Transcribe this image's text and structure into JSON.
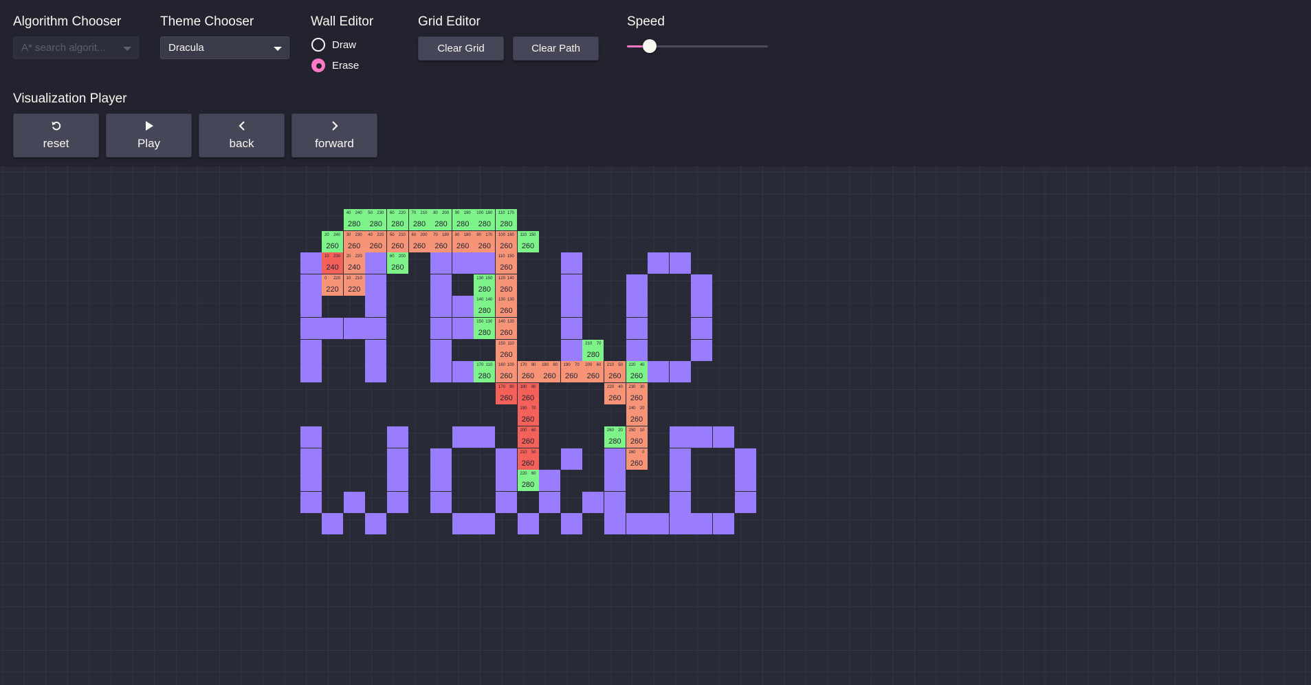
{
  "controls": {
    "algorithm_chooser": {
      "label": "Algorithm Chooser",
      "placeholder": "A* search algorit..."
    },
    "theme_chooser": {
      "label": "Theme Chooser",
      "value": "Dracula"
    },
    "wall_editor": {
      "label": "Wall Editor",
      "draw_label": "Draw",
      "erase_label": "Erase",
      "selected": "Erase"
    },
    "grid_editor": {
      "label": "Grid Editor",
      "clear_grid": "Clear Grid",
      "clear_path": "Clear Path"
    },
    "speed": {
      "label": "Speed",
      "level": 0.14
    },
    "player": {
      "label": "Visualization Player",
      "reset": "reset",
      "play": "Play",
      "back": "back",
      "forward": "forward"
    }
  },
  "icons": {
    "reset": "reset-icon",
    "play": "play-icon",
    "back": "chevron-left-icon",
    "forward": "chevron-right-icon",
    "dropdown": "caret-down-icon"
  },
  "colors": {
    "background": "#282a36",
    "panel": "#22232e",
    "accent": "#ff79c6",
    "wall": "#9a7cfe",
    "open": "#7ef38a",
    "closed": "#f79478",
    "path": "#f4605a"
  },
  "grid": {
    "walls": [
      [
        4,
        11
      ],
      [
        4,
        14
      ],
      [
        4,
        17
      ],
      [
        4,
        18
      ],
      [
        4,
        19
      ],
      [
        4,
        20
      ],
      [
        4,
        23
      ],
      [
        4,
        27
      ],
      [
        4,
        28
      ],
      [
        5,
        11
      ],
      [
        5,
        14
      ],
      [
        5,
        17
      ],
      [
        5,
        23
      ],
      [
        5,
        26
      ],
      [
        5,
        29
      ],
      [
        6,
        11
      ],
      [
        6,
        14
      ],
      [
        6,
        17
      ],
      [
        6,
        18
      ],
      [
        6,
        23
      ],
      [
        6,
        26
      ],
      [
        6,
        29
      ],
      [
        7,
        11
      ],
      [
        7,
        12
      ],
      [
        7,
        13
      ],
      [
        7,
        14
      ],
      [
        7,
        17
      ],
      [
        7,
        18
      ],
      [
        7,
        19
      ],
      [
        7,
        23
      ],
      [
        7,
        26
      ],
      [
        7,
        29
      ],
      [
        8,
        11
      ],
      [
        8,
        14
      ],
      [
        8,
        17
      ],
      [
        8,
        23
      ],
      [
        8,
        26
      ],
      [
        8,
        29
      ],
      [
        9,
        11
      ],
      [
        9,
        14
      ],
      [
        9,
        17
      ],
      [
        9,
        18
      ],
      [
        9,
        19
      ],
      [
        9,
        21
      ],
      [
        9,
        22
      ],
      [
        9,
        24
      ],
      [
        9,
        25
      ],
      [
        9,
        27
      ],
      [
        9,
        28
      ],
      [
        12,
        11
      ],
      [
        12,
        15
      ],
      [
        12,
        18
      ],
      [
        12,
        19
      ],
      [
        12,
        25
      ],
      [
        12,
        28
      ],
      [
        12,
        29
      ],
      [
        12,
        30
      ],
      [
        13,
        11
      ],
      [
        13,
        15
      ],
      [
        13,
        17
      ],
      [
        13,
        20
      ],
      [
        13,
        23
      ],
      [
        13,
        25
      ],
      [
        13,
        28
      ],
      [
        13,
        31
      ],
      [
        14,
        11
      ],
      [
        14,
        15
      ],
      [
        14,
        17
      ],
      [
        14,
        20
      ],
      [
        14,
        22
      ],
      [
        14,
        25
      ],
      [
        14,
        28
      ],
      [
        14,
        31
      ],
      [
        15,
        11
      ],
      [
        15,
        13
      ],
      [
        15,
        15
      ],
      [
        15,
        17
      ],
      [
        15,
        20
      ],
      [
        15,
        22
      ],
      [
        15,
        24
      ],
      [
        15,
        25
      ],
      [
        15,
        28
      ],
      [
        15,
        31
      ],
      [
        16,
        12
      ],
      [
        16,
        14
      ],
      [
        16,
        18
      ],
      [
        16,
        19
      ],
      [
        16,
        21
      ],
      [
        16,
        23
      ],
      [
        16,
        25
      ],
      [
        16,
        26
      ],
      [
        16,
        27
      ],
      [
        16,
        28
      ],
      [
        16,
        29
      ],
      [
        16,
        30
      ]
    ],
    "nodes": [
      {
        "r": 2,
        "c": 13,
        "s": "open",
        "g": "40",
        "h": "240",
        "f": "280"
      },
      {
        "r": 2,
        "c": 14,
        "s": "open",
        "g": "50",
        "h": "230",
        "f": "280"
      },
      {
        "r": 2,
        "c": 15,
        "s": "open",
        "g": "60",
        "h": "220",
        "f": "280"
      },
      {
        "r": 2,
        "c": 16,
        "s": "open",
        "g": "70",
        "h": "210",
        "f": "280"
      },
      {
        "r": 2,
        "c": 17,
        "s": "open",
        "g": "80",
        "h": "200",
        "f": "280"
      },
      {
        "r": 2,
        "c": 18,
        "s": "open",
        "g": "90",
        "h": "190",
        "f": "280"
      },
      {
        "r": 2,
        "c": 19,
        "s": "open",
        "g": "100",
        "h": "180",
        "f": "280"
      },
      {
        "r": 2,
        "c": 20,
        "s": "open",
        "g": "110",
        "h": "170",
        "f": "280"
      },
      {
        "r": 3,
        "c": 12,
        "s": "open",
        "g": "20",
        "h": "240",
        "f": "260"
      },
      {
        "r": 3,
        "c": 13,
        "s": "closed",
        "g": "30",
        "h": "230",
        "f": "260"
      },
      {
        "r": 3,
        "c": 14,
        "s": "closed",
        "g": "40",
        "h": "220",
        "f": "260"
      },
      {
        "r": 3,
        "c": 15,
        "s": "closed",
        "g": "50",
        "h": "210",
        "f": "260"
      },
      {
        "r": 3,
        "c": 16,
        "s": "closed",
        "g": "60",
        "h": "200",
        "f": "260"
      },
      {
        "r": 3,
        "c": 17,
        "s": "closed",
        "g": "70",
        "h": "190",
        "f": "260"
      },
      {
        "r": 3,
        "c": 18,
        "s": "closed",
        "g": "80",
        "h": "180",
        "f": "260"
      },
      {
        "r": 3,
        "c": 19,
        "s": "closed",
        "g": "90",
        "h": "170",
        "f": "260"
      },
      {
        "r": 3,
        "c": 20,
        "s": "closed",
        "g": "100",
        "h": "160",
        "f": "260"
      },
      {
        "r": 3,
        "c": 21,
        "s": "open",
        "g": "110",
        "h": "150",
        "f": "260"
      },
      {
        "r": 4,
        "c": 12,
        "s": "path",
        "g": "10",
        "h": "230",
        "f": "240"
      },
      {
        "r": 4,
        "c": 13,
        "s": "closed",
        "g": "20",
        "h": "220",
        "f": "240"
      },
      {
        "r": 4,
        "c": 15,
        "s": "open",
        "g": "60",
        "h": "200",
        "f": "260"
      },
      {
        "r": 4,
        "c": 20,
        "s": "closed",
        "g": "110",
        "h": "150",
        "f": "260"
      },
      {
        "r": 5,
        "c": 12,
        "s": "closed",
        "g": "0",
        "h": "220",
        "f": "220"
      },
      {
        "r": 5,
        "c": 13,
        "s": "closed",
        "g": "10",
        "h": "210",
        "f": "220"
      },
      {
        "r": 5,
        "c": 19,
        "s": "open",
        "g": "130",
        "h": "150",
        "f": "280"
      },
      {
        "r": 5,
        "c": 20,
        "s": "closed",
        "g": "120",
        "h": "140",
        "f": "260"
      },
      {
        "r": 6,
        "c": 19,
        "s": "open",
        "g": "140",
        "h": "140",
        "f": "280"
      },
      {
        "r": 6,
        "c": 20,
        "s": "closed",
        "g": "130",
        "h": "130",
        "f": "260"
      },
      {
        "r": 7,
        "c": 19,
        "s": "open",
        "g": "150",
        "h": "130",
        "f": "280"
      },
      {
        "r": 7,
        "c": 20,
        "s": "closed",
        "g": "140",
        "h": "120",
        "f": "260"
      },
      {
        "r": 8,
        "c": 20,
        "s": "closed",
        "g": "150",
        "h": "110",
        "f": "260"
      },
      {
        "r": 8,
        "c": 24,
        "s": "open",
        "g": "210",
        "h": "70",
        "f": "280"
      },
      {
        "r": 9,
        "c": 19,
        "s": "open",
        "g": "170",
        "h": "110",
        "f": "280"
      },
      {
        "r": 9,
        "c": 20,
        "s": "closed",
        "g": "160",
        "h": "100",
        "f": "260"
      },
      {
        "r": 9,
        "c": 21,
        "s": "closed",
        "g": "170",
        "h": "90",
        "f": "260"
      },
      {
        "r": 9,
        "c": 22,
        "s": "closed",
        "g": "180",
        "h": "80",
        "f": "260"
      },
      {
        "r": 9,
        "c": 23,
        "s": "closed",
        "g": "190",
        "h": "70",
        "f": "260"
      },
      {
        "r": 9,
        "c": 24,
        "s": "closed",
        "g": "200",
        "h": "60",
        "f": "260"
      },
      {
        "r": 9,
        "c": 25,
        "s": "closed",
        "g": "210",
        "h": "50",
        "f": "260"
      },
      {
        "r": 9,
        "c": 26,
        "s": "open",
        "g": "220",
        "h": "40",
        "f": "260"
      },
      {
        "r": 10,
        "c": 20,
        "s": "path",
        "g": "170",
        "h": "90",
        "f": "260"
      },
      {
        "r": 10,
        "c": 21,
        "s": "path",
        "g": "180",
        "h": "80",
        "f": "260"
      },
      {
        "r": 10,
        "c": 25,
        "s": "closed",
        "g": "220",
        "h": "40",
        "f": "260"
      },
      {
        "r": 10,
        "c": 26,
        "s": "closed",
        "g": "230",
        "h": "30",
        "f": "260"
      },
      {
        "r": 11,
        "c": 21,
        "s": "path",
        "g": "190",
        "h": "70",
        "f": "260"
      },
      {
        "r": 11,
        "c": 26,
        "s": "closed",
        "g": "240",
        "h": "20",
        "f": "260"
      },
      {
        "r": 12,
        "c": 21,
        "s": "path",
        "g": "200",
        "h": "60",
        "f": "260"
      },
      {
        "r": 12,
        "c": 25,
        "s": "open",
        "g": "260",
        "h": "20",
        "f": "280"
      },
      {
        "r": 12,
        "c": 26,
        "s": "closed",
        "g": "250",
        "h": "10",
        "f": "260"
      },
      {
        "r": 13,
        "c": 21,
        "s": "path",
        "g": "210",
        "h": "50",
        "f": "260"
      },
      {
        "r": 13,
        "c": 26,
        "s": "closed",
        "g": "260",
        "h": "0",
        "f": "260"
      },
      {
        "r": 14,
        "c": 21,
        "s": "open",
        "g": "220",
        "h": "60",
        "f": "280"
      }
    ]
  }
}
